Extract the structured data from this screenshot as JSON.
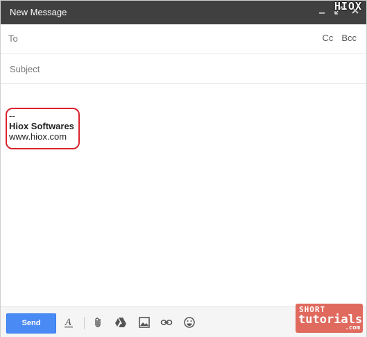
{
  "window": {
    "title": "New Message",
    "watermark_logo": "HIOX",
    "controls": {
      "minimize_icon": "minimize-icon",
      "expand_icon": "expand-icon",
      "close_icon": "close-icon"
    }
  },
  "compose": {
    "to_label": "To",
    "to_value": "",
    "cc_label": "Cc",
    "bcc_label": "Bcc",
    "subject_placeholder": "Subject",
    "subject_value": ""
  },
  "signature": {
    "separator": "--",
    "name": "Hiox Softwares",
    "website": "www.hiox.com",
    "highlight_color": "#d9232e"
  },
  "toolbar": {
    "send_label": "Send",
    "send_color": "#4a8af4",
    "icons": [
      "formatting-icon",
      "attach-icon",
      "drive-icon",
      "insert-photo-icon",
      "insert-link-icon",
      "emoji-icon"
    ]
  },
  "branding": {
    "line1": "SHORT",
    "line2": "tutorials",
    "line3": ".com",
    "color": "#e06a5e"
  }
}
